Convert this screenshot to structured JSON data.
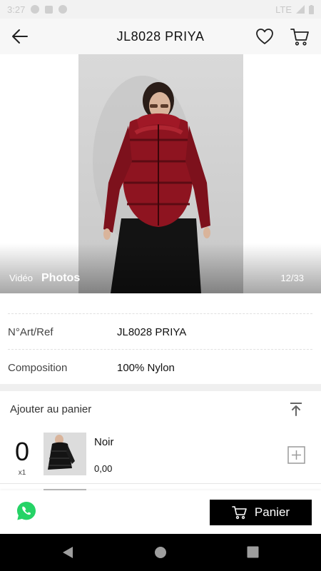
{
  "status_bar": {
    "time": "3:27",
    "network": "LTE"
  },
  "header": {
    "title": "JL8028 PRIYA"
  },
  "gallery": {
    "tab_video": "Vidéo",
    "tab_photos": "Photos",
    "counter": "12/33"
  },
  "specs": [
    {
      "key": "N°Art/Ref",
      "value": "JL8028 PRIYA"
    },
    {
      "key": "Composition",
      "value": "100% Nylon"
    }
  ],
  "cart_section": {
    "title": "Ajouter au panier",
    "variants": [
      {
        "quantity": "0",
        "multiplier": "x1",
        "color": "Noir",
        "price": "0,00"
      }
    ]
  },
  "bottom_bar": {
    "cart_label": "Panier"
  },
  "colors": {
    "accent": "#000000",
    "whatsapp": "#25D366",
    "jacket": "#8e1420"
  }
}
